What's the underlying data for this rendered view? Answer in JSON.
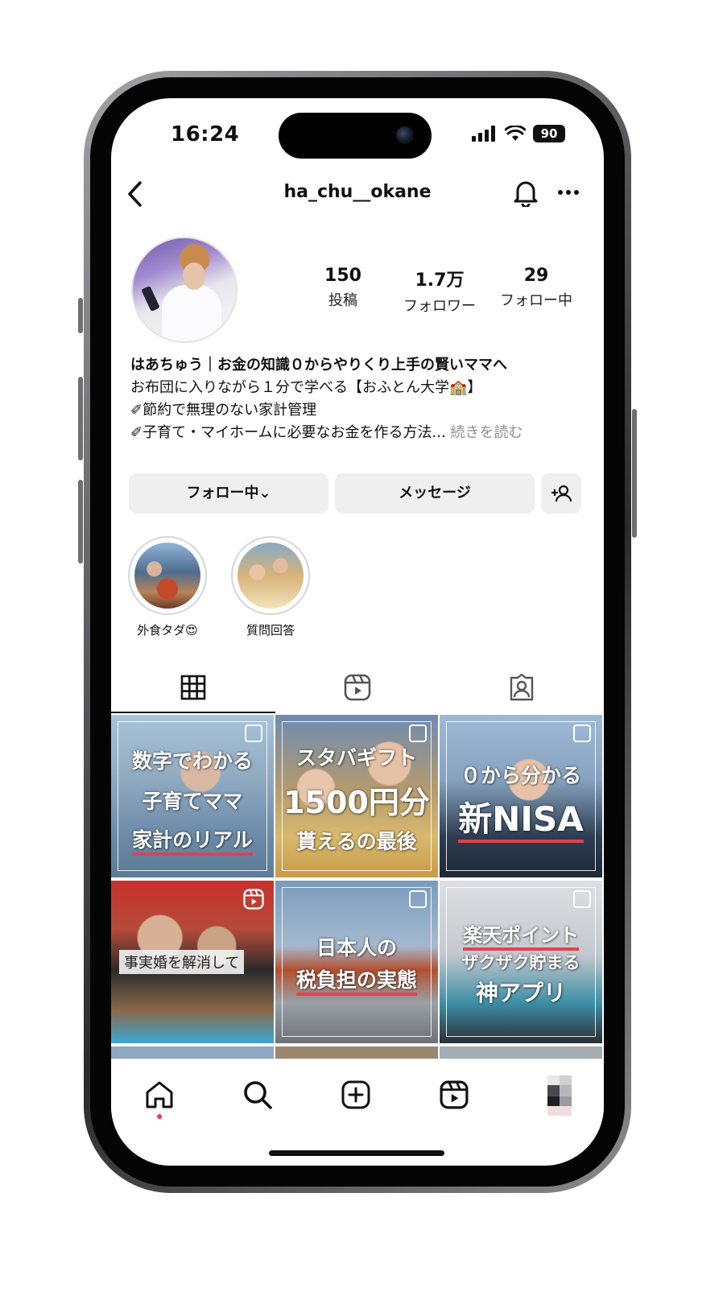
{
  "status": {
    "time": "16:24",
    "battery": "90"
  },
  "nav": {
    "username": "ha_chu__okane"
  },
  "profile": {
    "stats": [
      {
        "value": "150",
        "label": "投稿"
      },
      {
        "value": "1.7万",
        "label": "フォロワー"
      },
      {
        "value": "29",
        "label": "フォロー中"
      }
    ],
    "bio": {
      "name": "はあちゅう｜お金の知識０からやりくり上手の賢いママへ",
      "line1": "お布団に入りながら１分で学べる【おふとん大学🏫】",
      "line2": "✐節約で無理のない家計管理",
      "line3": "✐子育て・マイホームに必要なお金を作る方法...",
      "more": "続きを読む"
    }
  },
  "buttons": {
    "following": "フォロー中⌄",
    "message": "メッセージ"
  },
  "highlights": [
    {
      "label": "外食タダ😍"
    },
    {
      "label": "質問回答"
    }
  ],
  "grid": {
    "tiles": [
      {
        "lines": [
          "数字でわかる",
          "子育てママ",
          "家計のリアル"
        ]
      },
      {
        "lines": [
          "スタバギフト",
          "1500円分",
          "貰えるの最後"
        ]
      },
      {
        "lines": [
          "０から分かる",
          "新NISA"
        ]
      },
      {
        "lines": [
          "事実婚を解消して"
        ]
      },
      {
        "lines": [
          "日本人の",
          "税負担の実態"
        ]
      },
      {
        "lines": [
          "楽天ポイント",
          "ザクザク貯まる",
          "神アプリ"
        ]
      }
    ]
  },
  "icons": {
    "back": "chevron-left-icon",
    "bell": "bell-icon",
    "more": "more-horizontal-icon",
    "add_person": "add-person-icon",
    "grid": "grid-icon",
    "reels": "reels-icon",
    "tagged": "tagged-icon",
    "home": "home-icon",
    "search": "search-icon",
    "create": "create-icon",
    "reels_nav": "reels-icon"
  },
  "colors": {
    "accent_underline": "#e0424f",
    "notification_dot": "#ff3040"
  }
}
